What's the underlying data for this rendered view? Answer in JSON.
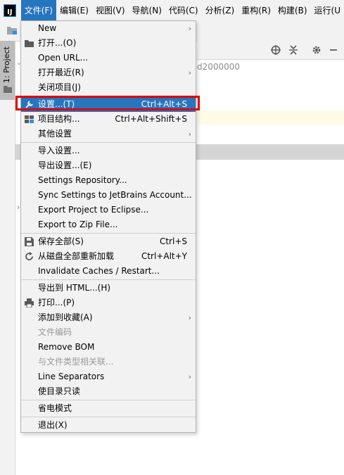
{
  "menubar": {
    "logo": "IJ",
    "items": [
      "文件(F)",
      "编辑(E)",
      "视图(V)",
      "导航(N)",
      "代码(C)",
      "分析(Z)",
      "重构(R)",
      "构建(B)",
      "运行(U"
    ]
  },
  "side": {
    "tab_label": "1: Project"
  },
  "background": {
    "text": "d2000000"
  },
  "menu": {
    "items": [
      {
        "label": "New",
        "arrow": "›"
      },
      {
        "label": "打开...(O)"
      },
      {
        "label": "Open URL..."
      },
      {
        "label": "打开最近(R)",
        "arrow": "›"
      },
      {
        "label": "关闭项目(J)"
      },
      {
        "label": "设置...(T)",
        "shortcut": "Ctrl+Alt+S"
      },
      {
        "label": "项目结构...",
        "shortcut": "Ctrl+Alt+Shift+S"
      },
      {
        "label": "其他设置",
        "arrow": "›"
      },
      {
        "label": "导入设置..."
      },
      {
        "label": "导出设置...(E)"
      },
      {
        "label": "Settings Repository..."
      },
      {
        "label": "Sync Settings to JetBrains Account..."
      },
      {
        "label": "Export Project to Eclipse..."
      },
      {
        "label": "Export to Zip File..."
      },
      {
        "label": "保存全部(S)",
        "shortcut": "Ctrl+S"
      },
      {
        "label": "从磁盘全部重新加载",
        "shortcut": "Ctrl+Alt+Y"
      },
      {
        "label": "Invalidate Caches / Restart..."
      },
      {
        "label": "导出到 HTML...(H)"
      },
      {
        "label": "打印...(P)"
      },
      {
        "label": "添加到收藏(A)",
        "arrow": "›"
      },
      {
        "label": "文件编码"
      },
      {
        "label": "Remove BOM"
      },
      {
        "label": "与文件类型相关联..."
      },
      {
        "label": "Line Separators",
        "arrow": "›"
      },
      {
        "label": "使目录只读"
      },
      {
        "label": "省电模式"
      },
      {
        "label": "退出(X)"
      }
    ]
  },
  "colors": {
    "accent": "#2675bf",
    "highlight": "#e00000",
    "menu_bg": "#f2f2f2"
  }
}
